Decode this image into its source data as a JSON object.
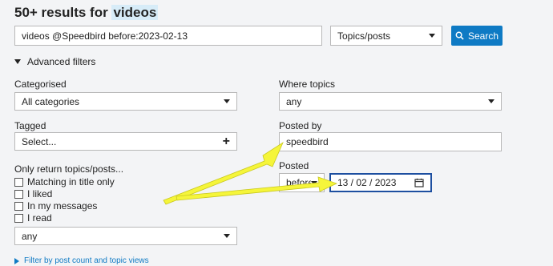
{
  "header": {
    "title_prefix": "50+ results for",
    "title_term": "videos"
  },
  "search": {
    "query": "videos @Speedbird before:2023-02-13",
    "type_value": "Topics/posts",
    "button_label": "Search"
  },
  "advanced": {
    "toggle_label": "Advanced filters"
  },
  "categorised": {
    "label": "Categorised",
    "value": "All categories"
  },
  "tagged": {
    "label": "Tagged",
    "value": "Select..."
  },
  "only_return": {
    "label": "Only return topics/posts...",
    "options": [
      "Matching in title only",
      "I liked",
      "In my messages",
      "I read"
    ],
    "select_value": "any"
  },
  "where_topics": {
    "label": "Where topics",
    "value": "any"
  },
  "posted_by": {
    "label": "Posted by",
    "value": "speedbird"
  },
  "posted": {
    "label": "Posted",
    "qualifier": "before",
    "date_value": "13 / 02 / 2023"
  },
  "footer": {
    "post_count_link": "Filter by post count and topic views"
  },
  "colors": {
    "accent": "#0e7ac4",
    "annotation_arrow": "#f5f53a",
    "date_focus": "#1d4fa0"
  }
}
